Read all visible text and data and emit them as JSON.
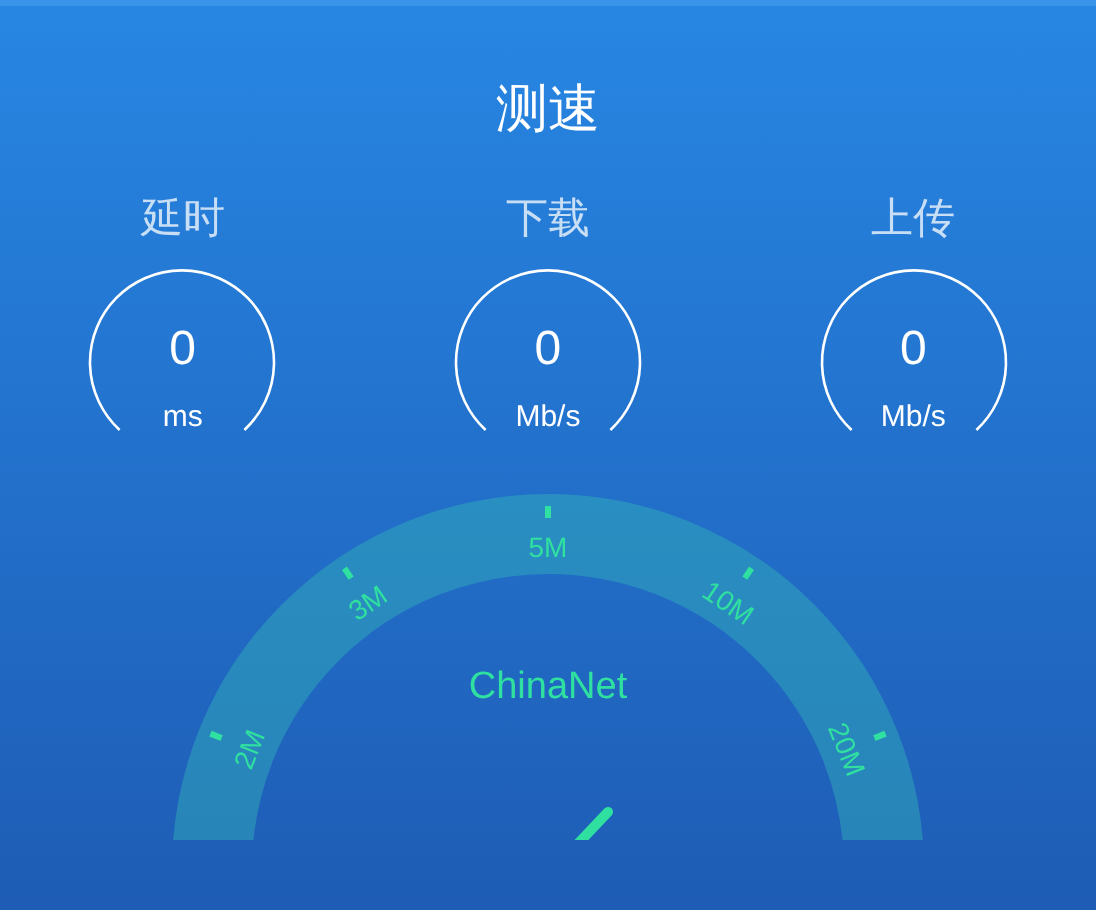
{
  "title": "测速",
  "metrics": [
    {
      "label": "延时",
      "value": "0",
      "unit": "ms"
    },
    {
      "label": "下载",
      "value": "0",
      "unit": "Mb/s"
    },
    {
      "label": "上传",
      "value": "0",
      "unit": "Mb/s"
    }
  ],
  "gauge": {
    "network": "ChinaNet",
    "ticks": [
      {
        "label": "2M"
      },
      {
        "label": "3M"
      },
      {
        "label": "5M"
      },
      {
        "label": "10M"
      },
      {
        "label": "20M"
      }
    ]
  }
}
